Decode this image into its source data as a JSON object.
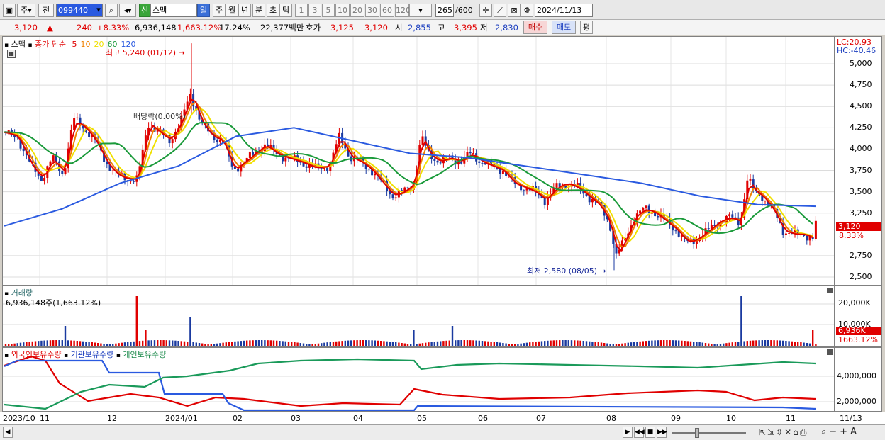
{
  "toolbar": {
    "period_label": "주",
    "prev_label": "전",
    "code": "099440",
    "name_badge": "신",
    "name": "스맥",
    "tabs": [
      "일",
      "주",
      "월",
      "년",
      "분",
      "초",
      "틱"
    ],
    "nums": [
      "1",
      "3",
      "5",
      "10",
      "20",
      "30",
      "60",
      "120"
    ],
    "count": "265",
    "count_total": "/600",
    "date": "2024/11/13"
  },
  "quote": {
    "price": "3,120",
    "change": "240",
    "change_pct": "+8.33%",
    "volume": "6,936,148",
    "volume_pct": "1,663.12%",
    "turnover": "17.24%",
    "amount": "22,377백만",
    "ask_label": "호가",
    "ask": "3,125",
    "bid": "3,120",
    "open_label": "시",
    "open": "2,855",
    "high_label": "고",
    "high": "3,395",
    "low_label": "저",
    "low": "2,830",
    "buy_label": "매수",
    "sell_label": "매도",
    "misc_label": "평"
  },
  "price_pane": {
    "name": "스맥",
    "ma_title": "종가 단순",
    "ma_periods": [
      "5",
      "10",
      "20",
      "60",
      "120"
    ],
    "ma_colors": [
      "#e00000",
      "#f08000",
      "#f0e000",
      "#1a9a3a",
      "#2a5ae0"
    ],
    "high_note": "최고 5,240 (01/12)",
    "low_note": "최저 2,580 (08/05)",
    "dividend_note": "배당락(0.00%)",
    "lc": "LC:20.93",
    "hc": "HC:-40.46",
    "price_ticks": [
      "5,000",
      "4,750",
      "4,500",
      "4,250",
      "4,000",
      "3,750",
      "3,500",
      "3,250",
      "2,750",
      "2,500"
    ],
    "last_price": "3,120",
    "last_pct": "8.33%"
  },
  "volume_pane": {
    "title": "거래량",
    "value": "6,936,148주(1,663.12%)",
    "ticks": [
      "20,000K",
      "10,000K"
    ],
    "last": "6,936K",
    "last_pct": "1663.12%"
  },
  "holding_pane": {
    "series": [
      "외국인보유수량",
      "기관보유수량",
      "개인보유수량"
    ],
    "colors": [
      "#e00000",
      "#2a5ae0",
      "#1a9a5a"
    ],
    "ticks": [
      "4,000,000",
      "2,000,000"
    ]
  },
  "x_axis": {
    "labels": [
      "2023/10",
      "11",
      "12",
      "2024/01",
      "02",
      "03",
      "04",
      "05",
      "06",
      "07",
      "08",
      "09",
      "10",
      "11",
      "11/13"
    ]
  },
  "chart_data": {
    "type": "line",
    "title": "",
    "x": [
      "2023/10",
      "11",
      "12",
      "2024/01",
      "02",
      "03",
      "04",
      "05",
      "06",
      "07",
      "08",
      "09",
      "10",
      "11",
      "11/13"
    ],
    "price_range": [
      2500,
      5240
    ],
    "series": [
      {
        "name": "5",
        "values": [
          4200,
          3750,
          3900,
          4200,
          3800,
          3950,
          3650,
          4100,
          3800,
          3600,
          2850,
          3000,
          3450,
          3000,
          3120
        ]
      },
      {
        "name": "120",
        "values": [
          3100,
          3300,
          3600,
          3800,
          4150,
          4250,
          4100,
          3950,
          3900,
          3800,
          3700,
          3600,
          3450,
          3350,
          3330
        ]
      }
    ]
  }
}
